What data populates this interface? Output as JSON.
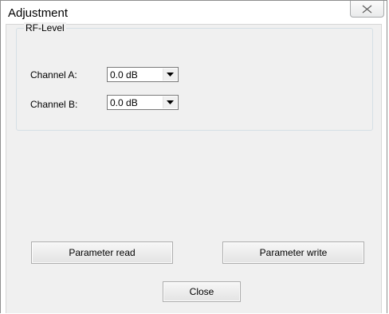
{
  "window": {
    "title": "Adjustment"
  },
  "rf_level": {
    "group_label": "RF-Level",
    "channel_a": {
      "label": "Channel A:",
      "value": "0.0 dB"
    },
    "channel_b": {
      "label": "Channel B:",
      "value": "0.0 dB"
    }
  },
  "buttons": {
    "parameter_read": "Parameter read",
    "parameter_write": "Parameter write",
    "close": "Close"
  },
  "icons": {
    "window_close": "close-icon",
    "dropdown": "chevron-down-icon"
  }
}
